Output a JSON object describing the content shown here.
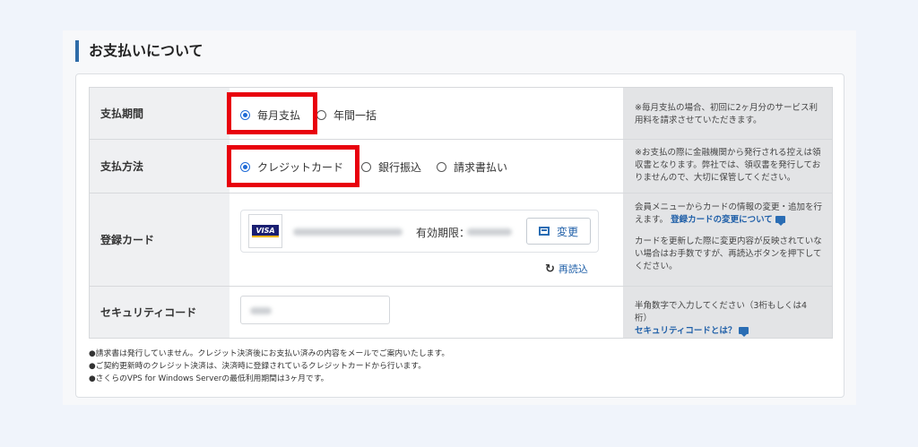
{
  "section": {
    "title": "お支払いについて"
  },
  "rows": {
    "period": {
      "label": "支払期間",
      "options": [
        "毎月支払",
        "年間一括"
      ],
      "note": "※毎月支払の場合、初回に2ヶ月分のサービス利用料を請求させていただきます。"
    },
    "method": {
      "label": "支払方法",
      "options": [
        "クレジットカード",
        "銀行振込",
        "請求書払い"
      ],
      "note": "※お支払の際に金融機関から発行される控えは領収書となります。弊社では、領収書を発行しておりませんので、大切に保管してください。"
    },
    "card": {
      "label": "登録カード",
      "brand": "VISA",
      "expiry_label": "有効期限：",
      "change_label": "変更",
      "reload_label": "再読込",
      "note_1": "会員メニューからカードの情報の変更・追加を行えます。",
      "note_link": "登録カードの変更について",
      "note_2": "カードを更新した際に変更内容が反映されていない場合はお手数ですが、再読込ボタンを押下してください。"
    },
    "security": {
      "label": "セキュリティコード",
      "note": "半角数字で入力してください（3桁もしくは4桁）",
      "note_link": "セキュリティコードとは？"
    }
  },
  "footnotes": [
    "●請求書は発行していません。クレジット決済後にお支払い済みの内容をメールでご案内いたします。",
    "●ご契約更新時のクレジット決済は、決済時に登録されているクレジットカードから行います。",
    "●さくらのVPS for Windows Serverの最低利用期間は3ヶ月です。"
  ],
  "colors": {
    "accent": "#2f6ca8",
    "highlight": "#e8000c",
    "link": "#1f5fa8"
  }
}
